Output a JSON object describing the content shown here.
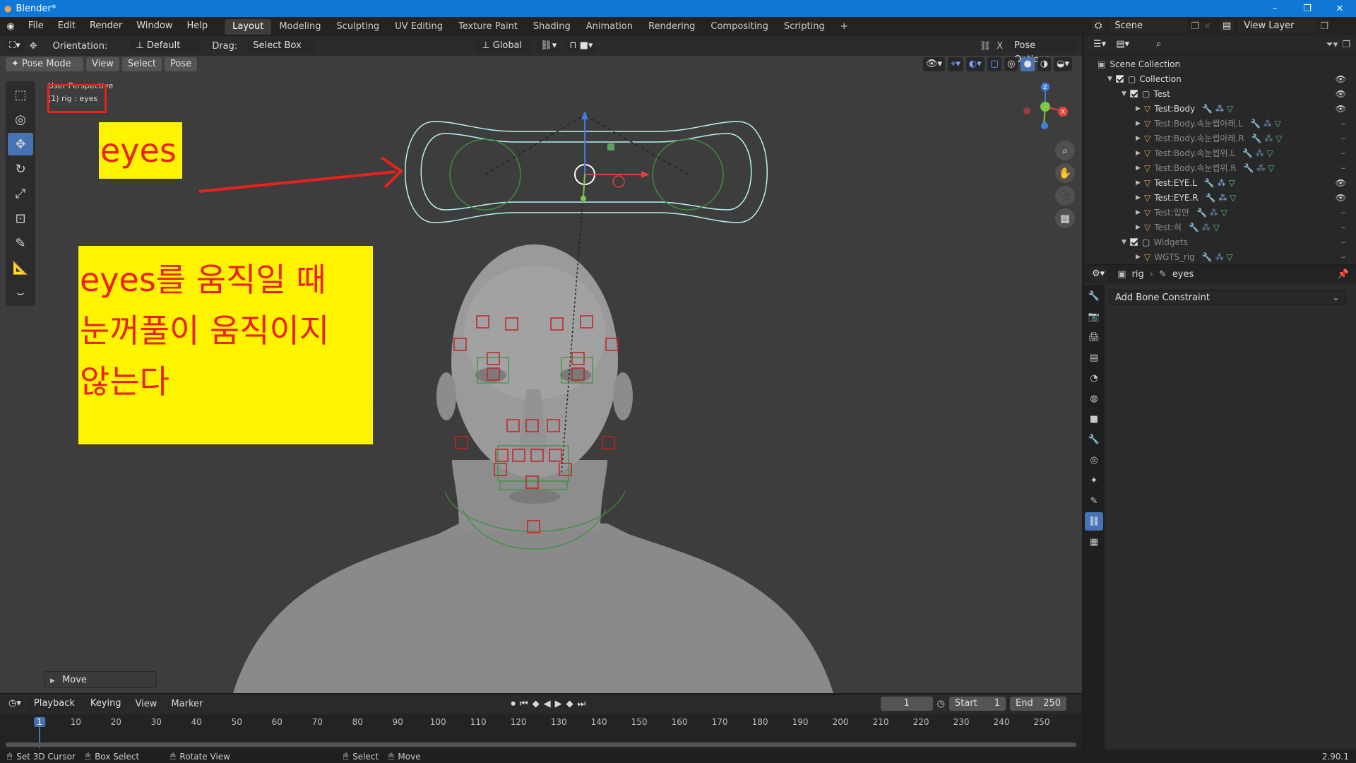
{
  "titlebar": {
    "title": "Blender*"
  },
  "menubar": {
    "menus": [
      "File",
      "Edit",
      "Render",
      "Window",
      "Help"
    ],
    "workspaces": [
      "Layout",
      "Modeling",
      "Sculpting",
      "UV Editing",
      "Texture Paint",
      "Shading",
      "Animation",
      "Rendering",
      "Compositing",
      "Scripting"
    ],
    "active_workspace": "Layout",
    "scene_label": "Scene",
    "view_layer_label": "View Layer"
  },
  "viewport_header": {
    "orientation_label": "Orientation:",
    "orientation_value": "Default",
    "drag_label": "Drag:",
    "drag_value": "Select Box",
    "transform_orientation": "Global",
    "pose_options": "Pose Options",
    "mode": "Pose Mode",
    "view_menu": "View",
    "select_menu": "Select",
    "pose_menu": "Pose"
  },
  "viewport": {
    "perspective_label": "User Perspective",
    "active_label": "(1) rig : eyes",
    "last_operator": "Move",
    "note_small": "eyes",
    "note_big_lines": [
      "eyes를 움직일 때",
      "눈꺼풀이 움직이지",
      "않는다"
    ]
  },
  "outliner": {
    "scene_collection": "Scene Collection",
    "items": [
      {
        "name": "Collection",
        "level": 1,
        "dim": false
      },
      {
        "name": "Test",
        "level": 2,
        "dim": false
      },
      {
        "name": "Test:Body",
        "level": 3,
        "dim": false
      },
      {
        "name": "Test:Body.속눈썹아래.L",
        "level": 3,
        "dim": true
      },
      {
        "name": "Test:Body.속눈썹아래.R",
        "level": 3,
        "dim": true
      },
      {
        "name": "Test:Body.속눈썹위.L",
        "level": 3,
        "dim": true
      },
      {
        "name": "Test:Body.속눈썹위.R",
        "level": 3,
        "dim": true
      },
      {
        "name": "Test:EYE.L",
        "level": 3,
        "dim": false
      },
      {
        "name": "Test:EYE.R",
        "level": 3,
        "dim": false
      },
      {
        "name": "Test:입안",
        "level": 3,
        "dim": true
      },
      {
        "name": "Test:혀",
        "level": 3,
        "dim": true
      },
      {
        "name": "Widgets",
        "level": 2,
        "dim": true
      },
      {
        "name": "WGTS_rig",
        "level": 3,
        "dim": true
      }
    ]
  },
  "properties": {
    "breadcrumb_object": "rig",
    "breadcrumb_bone": "eyes",
    "add_constraint": "Add Bone Constraint"
  },
  "timeline": {
    "playback": "Playback",
    "keying": "Keying",
    "view": "View",
    "marker": "Marker",
    "current_frame": "1",
    "start_label": "Start",
    "start_value": "1",
    "end_label": "End",
    "end_value": "250",
    "ticks": [
      "1",
      "10",
      "20",
      "30",
      "40",
      "50",
      "60",
      "70",
      "80",
      "90",
      "100",
      "110",
      "120",
      "130",
      "140",
      "150",
      "160",
      "170",
      "180",
      "190",
      "200",
      "210",
      "220",
      "230",
      "240",
      "250"
    ]
  },
  "statusbar": {
    "items": [
      "Set 3D Cursor",
      "Box Select",
      "Rotate View",
      "Select",
      "Move"
    ],
    "version": "2.90.1"
  },
  "colors": {
    "accent": "#4772b3",
    "titlebar": "#0f78d7",
    "note_bg": "#fff400",
    "note_text": "#e8221c"
  }
}
